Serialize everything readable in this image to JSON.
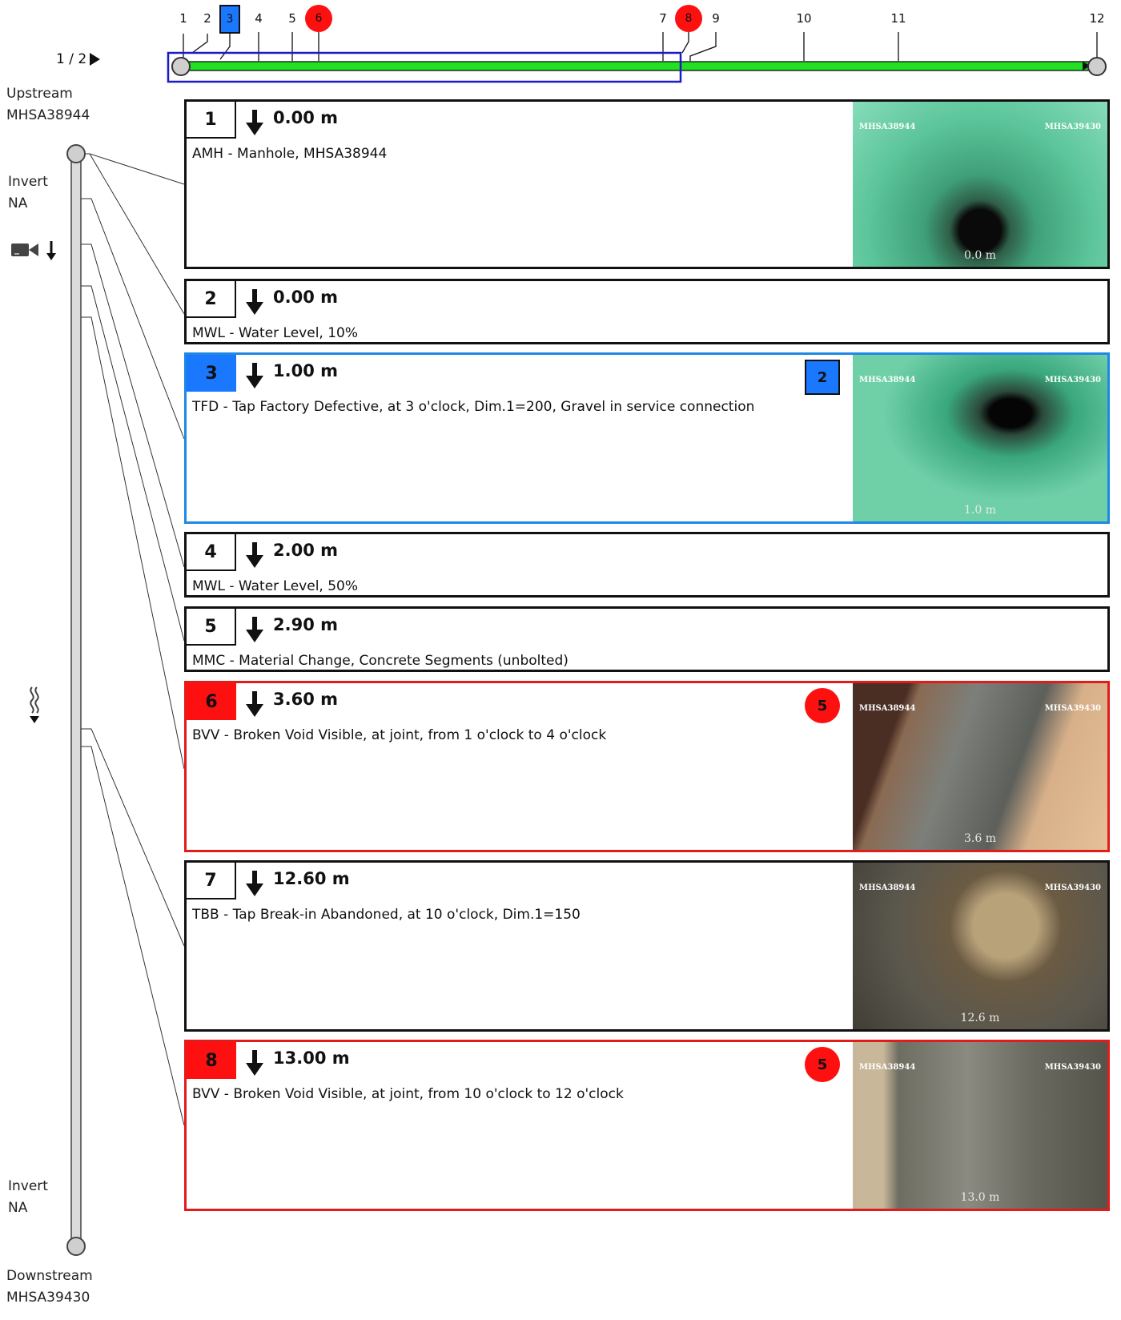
{
  "page_indicator": "1 / 2",
  "upstream": {
    "label": "Upstream",
    "id": "MHSA38944"
  },
  "downstream": {
    "label": "Downstream",
    "id": "MHSA39430"
  },
  "invert_top": {
    "label": "Invert",
    "value": "NA"
  },
  "invert_bottom": {
    "label": "Invert",
    "value": "NA"
  },
  "colors": {
    "bar_green": "#22e022",
    "view_blue": "#1a1ac8",
    "grade_blue": "#1a78ff",
    "grade_red": "#ff1010"
  },
  "icons": {
    "camera": "camera-direction-icon",
    "flow": "flow-direction-icon"
  },
  "overview_ticks": [
    {
      "label": "1",
      "style": "plain"
    },
    {
      "label": "2",
      "style": "plain"
    },
    {
      "label": "3",
      "style": "blue-square"
    },
    {
      "label": "4",
      "style": "plain"
    },
    {
      "label": "5",
      "style": "plain"
    },
    {
      "label": "6",
      "style": "red-circle"
    },
    {
      "label": "7",
      "style": "plain"
    },
    {
      "label": "8",
      "style": "red-circle"
    },
    {
      "label": "9",
      "style": "plain"
    },
    {
      "label": "10",
      "style": "plain"
    },
    {
      "label": "11",
      "style": "plain"
    },
    {
      "label": "12",
      "style": "plain"
    }
  ],
  "observations": [
    {
      "num": "1",
      "distance": "0.00 m",
      "desc": "AMH - Manhole, MHSA38944",
      "style": "plain",
      "grade": "",
      "photo": {
        "left": "MHSA38944",
        "right": "MHSA39430",
        "dist": "0.0 m"
      }
    },
    {
      "num": "2",
      "distance": "0.00 m",
      "desc": "MWL - Water Level, 10%",
      "style": "plain",
      "grade": ""
    },
    {
      "num": "3",
      "distance": "1.00 m",
      "desc": "TFD - Tap Factory Defective, at 3 o'clock, Dim.1=200, Gravel in service connection",
      "style": "blue",
      "grade": "2",
      "photo": {
        "left": "MHSA38944",
        "right": "MHSA39430",
        "dist": "1.0 m"
      }
    },
    {
      "num": "4",
      "distance": "2.00 m",
      "desc": "MWL - Water Level, 50%",
      "style": "plain",
      "grade": ""
    },
    {
      "num": "5",
      "distance": "2.90 m",
      "desc": "MMC - Material Change, Concrete Segments (unbolted)",
      "style": "plain",
      "grade": ""
    },
    {
      "num": "6",
      "distance": "3.60 m",
      "desc": "BVV - Broken Void Visible, at joint, from 1 o'clock to 4 o'clock",
      "style": "red",
      "grade": "5",
      "photo": {
        "left": "MHSA38944",
        "right": "MHSA39430",
        "dist": "3.6 m"
      }
    },
    {
      "num": "7",
      "distance": "12.60 m",
      "desc": "TBB - Tap Break-in Abandoned, at 10 o'clock, Dim.1=150",
      "style": "plain",
      "grade": "",
      "photo": {
        "left": "MHSA38944",
        "right": "MHSA39430",
        "dist": "12.6 m"
      }
    },
    {
      "num": "8",
      "distance": "13.00 m",
      "desc": "BVV - Broken Void Visible, at joint, from 10 o'clock to 12 o'clock",
      "style": "red",
      "grade": "5",
      "photo": {
        "left": "MHSA38944",
        "right": "MHSA39430",
        "dist": "13.0 m"
      }
    }
  ]
}
